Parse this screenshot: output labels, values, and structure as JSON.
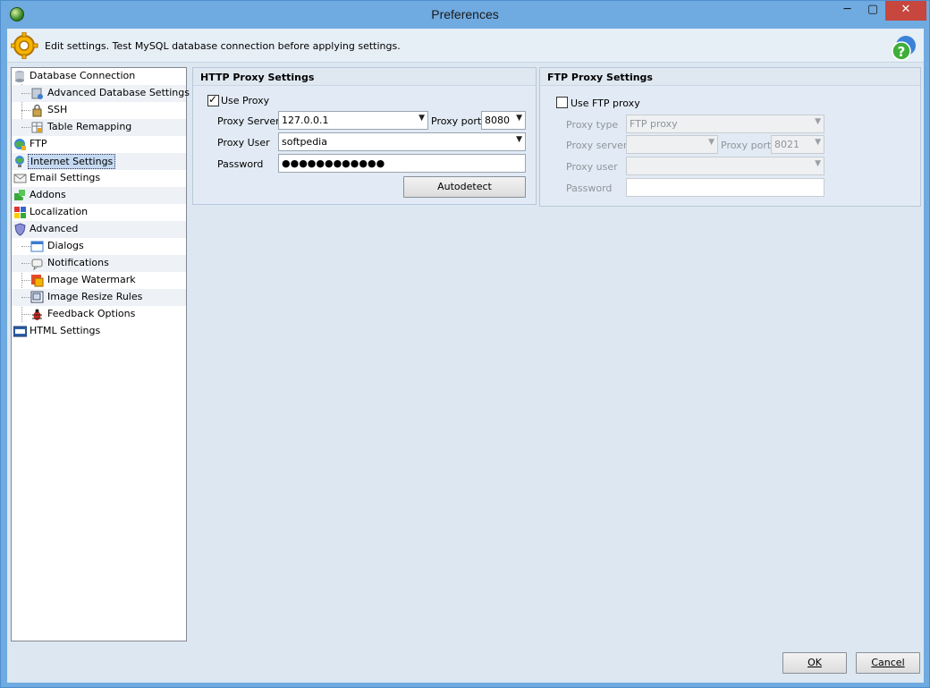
{
  "window": {
    "title": "Preferences",
    "minimize": "─",
    "maximize": "▢",
    "close": "✕"
  },
  "banner": {
    "text": "Edit settings. Test MySQL database connection before applying settings."
  },
  "tree": {
    "items": [
      {
        "label": "Database Connection",
        "icon": "database-icon"
      },
      {
        "label": "Advanced Database Settings",
        "icon": "database-settings-icon"
      },
      {
        "label": "SSH",
        "icon": "lock-icon"
      },
      {
        "label": "Table Remapping",
        "icon": "table-icon"
      },
      {
        "label": "FTP",
        "icon": "ftp-globe-icon"
      },
      {
        "label": "Internet Settings",
        "icon": "globe-icon"
      },
      {
        "label": "Email Settings",
        "icon": "email-icon"
      },
      {
        "label": "Addons",
        "icon": "puzzle-icon"
      },
      {
        "label": "Localization",
        "icon": "flags-icon"
      },
      {
        "label": "Advanced",
        "icon": "shield-icon"
      },
      {
        "label": "Dialogs",
        "icon": "dialog-icon"
      },
      {
        "label": "Notifications",
        "icon": "notification-icon"
      },
      {
        "label": "Image Watermark",
        "icon": "watermark-icon"
      },
      {
        "label": "Image Resize Rules",
        "icon": "resize-icon"
      },
      {
        "label": "Feedback Options",
        "icon": "bug-icon"
      },
      {
        "label": "HTML Settings",
        "icon": "html-icon"
      }
    ]
  },
  "http": {
    "title": "HTTP Proxy Settings",
    "use_proxy_label": "Use Proxy",
    "server_label": "Proxy Server",
    "server_value": "127.0.0.1",
    "port_label": "Proxy port",
    "port_value": "8080",
    "user_label": "Proxy User",
    "user_value": "softpedia",
    "password_label": "Password",
    "password_value": "●●●●●●●●●●●●",
    "autodetect_label": "Autodetect"
  },
  "ftp": {
    "title": "FTP Proxy Settings",
    "use_label": "Use FTP proxy",
    "type_label": "Proxy type",
    "type_value": "FTP proxy",
    "server_label": "Proxy server",
    "server_value": "",
    "port_label": "Proxy port",
    "port_value": "8021",
    "user_label": "Proxy user",
    "user_value": "",
    "password_label": "Password",
    "password_value": ""
  },
  "footer": {
    "ok_label": "OK",
    "cancel_label": "Cancel"
  },
  "colors": {
    "titlebar": "#6faae0",
    "close": "#c7463d",
    "selection": "#c5daf2"
  }
}
